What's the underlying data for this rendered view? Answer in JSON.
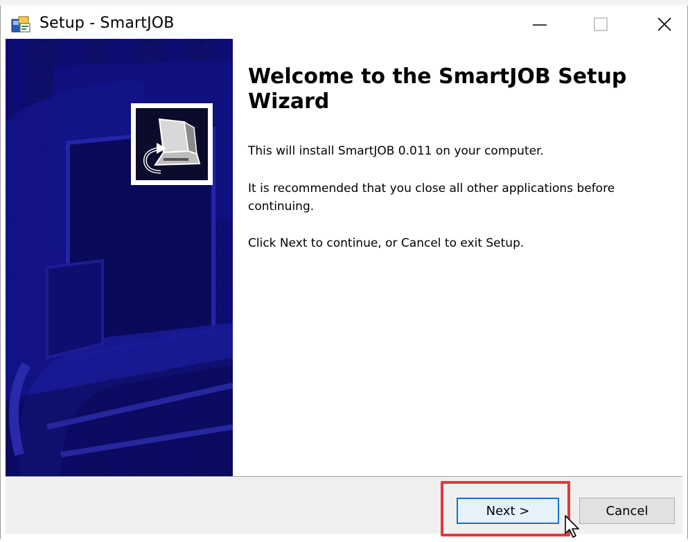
{
  "window": {
    "title": "Setup - SmartJOB",
    "caption_buttons": {
      "minimize_icon": "minimize-icon",
      "maximize_icon": "maximize-icon",
      "close_icon": "close-icon"
    }
  },
  "wizard": {
    "heading": "Welcome to the SmartJOB Setup Wizard",
    "paragraphs": [
      "This will install SmartJOB 0.011 on your computer.",
      "It is recommended that you close all other applications before continuing.",
      "Click Next to continue, or Cancel to exit Setup."
    ],
    "side_panel_color": "#0c0c6e"
  },
  "buttons": {
    "next_label": "Next >",
    "cancel_label": "Cancel"
  },
  "annotation": {
    "highlight_color": "#e0393e",
    "highlighted_target": "next-button"
  }
}
